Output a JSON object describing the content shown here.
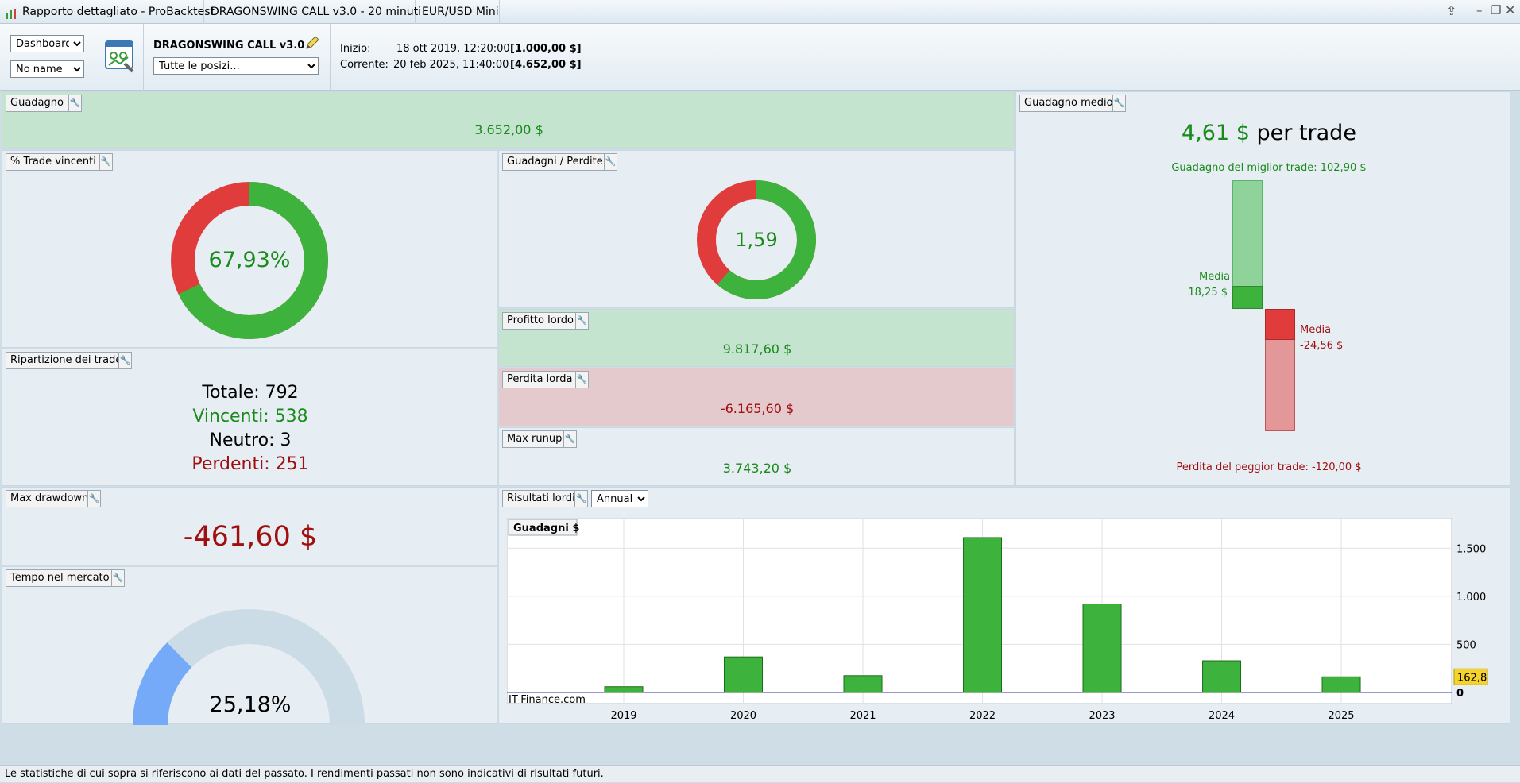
{
  "titlebar": {
    "app_title": "Rapporto dettagliato - ProBacktest",
    "strategy": "DRAGONSWING CALL v3.0 - 20 minuti",
    "instrument": "EUR/USD Mini"
  },
  "toolbar": {
    "view_select": "Dashboard",
    "name_select": "No name",
    "strategy_name": "DRAGONSWING CALL v3.0",
    "positions_select": "Tutte le posizi...",
    "start_label": "Inizio:",
    "start_date": "18 ott 2019, 12:20:00",
    "start_value": "[1.000,00 $]",
    "current_label": "Corrente:",
    "current_date": "20 feb 2025, 11:40:00",
    "current_value": "[4.652,00 $]"
  },
  "gain": {
    "title": "Guadagno",
    "value": "3.652,00 $"
  },
  "win_rate": {
    "title": "% Trade vincenti",
    "value": "67,93%",
    "fraction": 0.6793
  },
  "gain_loss": {
    "title": "Guadagni / Perdite",
    "value": "1,59",
    "fraction": 0.614
  },
  "gross_profit": {
    "title": "Profitto lordo",
    "value": "9.817,60 $"
  },
  "gross_loss": {
    "title": "Perdita lorda",
    "value": "-6.165,60 $"
  },
  "max_runup": {
    "title": "Max runup",
    "value": "3.743,20 $"
  },
  "breakdown": {
    "title": "Ripartizione dei trade",
    "total_label": "Totale: ",
    "total": "792",
    "winners_label": "Vincenti: ",
    "winners": "538",
    "neutral_label": "Neutro: ",
    "neutral": "3",
    "losers_label": "Perdenti: ",
    "losers": "251"
  },
  "avg_gain": {
    "title": "Guadagno medio",
    "value": "4,61 $",
    "suffix": " per trade",
    "best_label": "Guadagno del miglior trade: 102,90 $",
    "avg_win_label": "Media",
    "avg_win_value": "18,25 $",
    "avg_loss_label": "Media",
    "avg_loss_value": "-24,56 $",
    "worst_label": "Perdita del peggior trade: -120,00 $",
    "best": 102.9,
    "avg_win": 18.25,
    "avg_loss": -24.56,
    "worst": -120.0
  },
  "max_drawdown": {
    "title": "Max drawdown",
    "value": "-461,60 $"
  },
  "time_in_market": {
    "title": "Tempo nel mercato",
    "value": "25,18%",
    "fraction": 0.2518
  },
  "gross_results": {
    "title": "Risultati lordi",
    "period_select": "Annuale",
    "legend": "Guadagni $",
    "watermark": "IT-Finance.com",
    "current_value_badge": "162,8",
    "zero_label": "0"
  },
  "chart_data": {
    "type": "bar",
    "categories": [
      "2019",
      "2020",
      "2021",
      "2022",
      "2023",
      "2024",
      "2025"
    ],
    "values": [
      60,
      370,
      175,
      1610,
      920,
      330,
      162.8
    ],
    "yticks": [
      0,
      500,
      1000,
      1500
    ],
    "ytick_labels": [
      "0",
      "500",
      "1.000",
      "1.500"
    ],
    "ylim": [
      0,
      1750
    ],
    "ylabel": "",
    "xlabel": "",
    "colors": {
      "bar": "#3db33d",
      "bar_border": "#1a6e1a"
    }
  },
  "colors": {
    "green": "#3db33d",
    "red": "#e03c3c",
    "blue": "#74aaf8",
    "gauge_bg": "#ccdce6"
  },
  "footer": {
    "text": "Le statistiche di cui sopra si riferiscono ai dati del passato. I rendimenti passati non sono indicativi di risultati futuri."
  }
}
